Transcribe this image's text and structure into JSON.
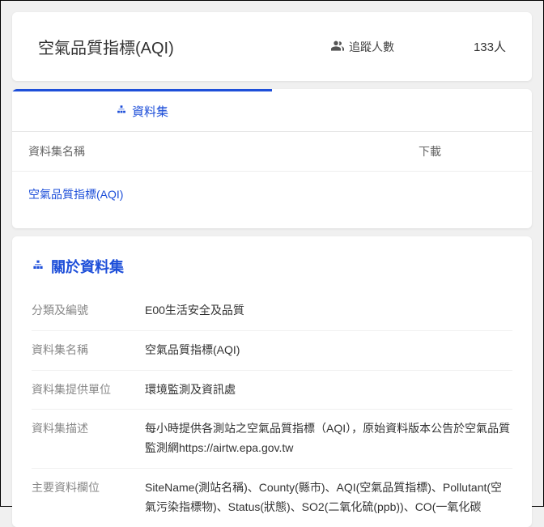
{
  "header": {
    "title": "空氣品質指標(AQI)",
    "followers_label": "追蹤人數",
    "followers_count": "133人"
  },
  "tab": {
    "label": "資料集"
  },
  "table": {
    "col_name": "資料集名稱",
    "col_download": "下載",
    "dataset_link": "空氣品質指標(AQI)"
  },
  "about": {
    "title": "關於資料集",
    "rows": [
      {
        "label": "分類及編號",
        "value": "E00生活安全及品質"
      },
      {
        "label": "資料集名稱",
        "value": "空氣品質指標(AQI)"
      },
      {
        "label": "資料集提供單位",
        "value": "環境監測及資訊處"
      },
      {
        "label": "資料集描述",
        "value": "每小時提供各測站之空氣品質指標（AQI），原始資料版本公告於空氣品質監測網https://airtw.epa.gov.tw"
      },
      {
        "label": "主要資料欄位",
        "value": "SiteName(測站名稱)、County(縣市)、AQI(空氣品質指標)、Pollutant(空氣污染指標物)、Status(狀態)、SO2(二氧化硫(ppb))、CO(一氧化碳"
      }
    ]
  }
}
